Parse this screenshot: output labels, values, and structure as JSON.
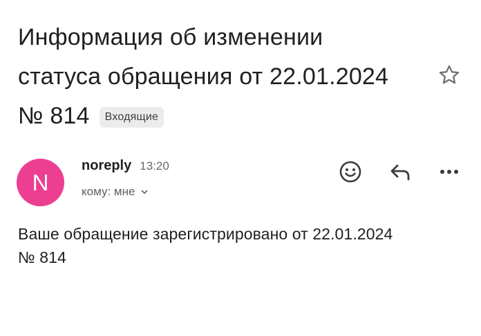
{
  "email": {
    "subject_lines": [
      "Информация об изменении",
      "статуса обращения от 22.01.2024",
      "№ 814"
    ],
    "label": "Входящие",
    "starred": false,
    "sender": {
      "avatar_letter": "N",
      "avatar_color": "#ec3f92",
      "name": "noreply",
      "time": "13:20",
      "recipient": "кому: мне"
    },
    "body_lines": [
      "Ваше обращение зарегистрировано от 22.01.2024",
      "№ 814"
    ]
  },
  "icons": {
    "star": "star-outline-icon",
    "emoji": "emoji-reaction-icon",
    "reply": "reply-icon",
    "more": "more-horizontal-icon",
    "recipient_toggle": "chevron-down-icon"
  }
}
